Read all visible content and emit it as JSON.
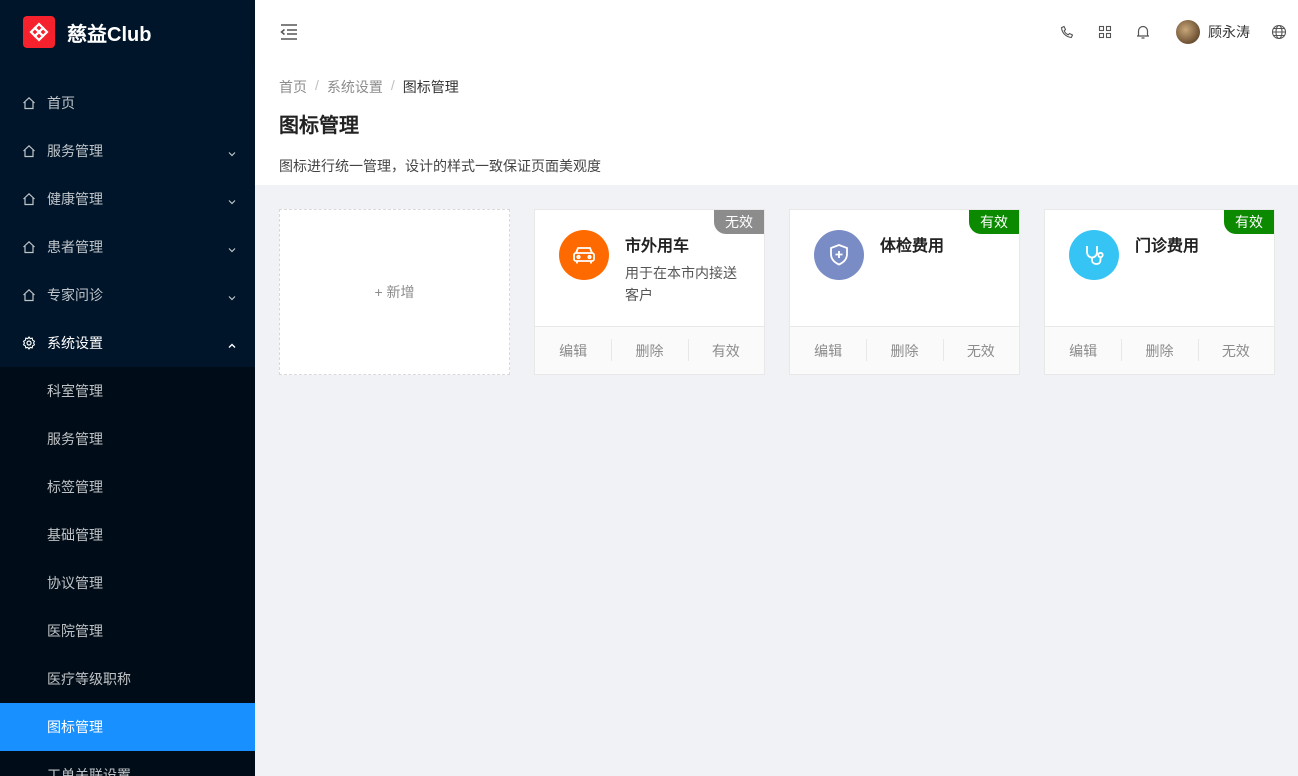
{
  "app": {
    "brand": "慈益Club"
  },
  "sidebar": {
    "items": [
      {
        "label": "首页",
        "icon": "home-icon"
      },
      {
        "label": "服务管理",
        "icon": "home-icon"
      },
      {
        "label": "健康管理",
        "icon": "home-icon"
      },
      {
        "label": "患者管理",
        "icon": "home-icon"
      },
      {
        "label": "专家问诊",
        "icon": "home-icon"
      },
      {
        "label": "系统设置",
        "icon": "gear-icon"
      }
    ],
    "sub_items": [
      {
        "label": "科室管理"
      },
      {
        "label": "服务管理"
      },
      {
        "label": "标签管理"
      },
      {
        "label": "基础管理"
      },
      {
        "label": "协议管理"
      },
      {
        "label": "医院管理"
      },
      {
        "label": "医疗等级职称"
      },
      {
        "label": "图标管理"
      },
      {
        "label": "工单关联设置"
      }
    ]
  },
  "header": {
    "user_name": "顾永涛"
  },
  "breadcrumb": [
    "首页",
    "系统设置",
    "图标管理"
  ],
  "page": {
    "title": "图标管理",
    "description": "图标进行统一管理，设计的样式一致保证页面美观度"
  },
  "add_card": {
    "label": "+ 新增"
  },
  "cards": [
    {
      "title": "市外用车",
      "desc": "用于在本市内接送客户",
      "status": "无效",
      "status_color": "#8c8c8c",
      "icon_color": "#ff6a00",
      "icon": "car-icon",
      "actions": [
        "编辑",
        "删除",
        "有效"
      ]
    },
    {
      "title": "体检费用",
      "desc": "",
      "status": "有效",
      "status_color": "#0b8a00",
      "icon_color": "#7a8cc6",
      "icon": "shield-plus-icon",
      "actions": [
        "编辑",
        "删除",
        "无效"
      ]
    },
    {
      "title": "门诊费用",
      "desc": "",
      "status": "有效",
      "status_color": "#0b8a00",
      "icon_color": "#36c4f5",
      "icon": "stethoscope-icon",
      "actions": [
        "编辑",
        "删除",
        "无效"
      ]
    }
  ]
}
